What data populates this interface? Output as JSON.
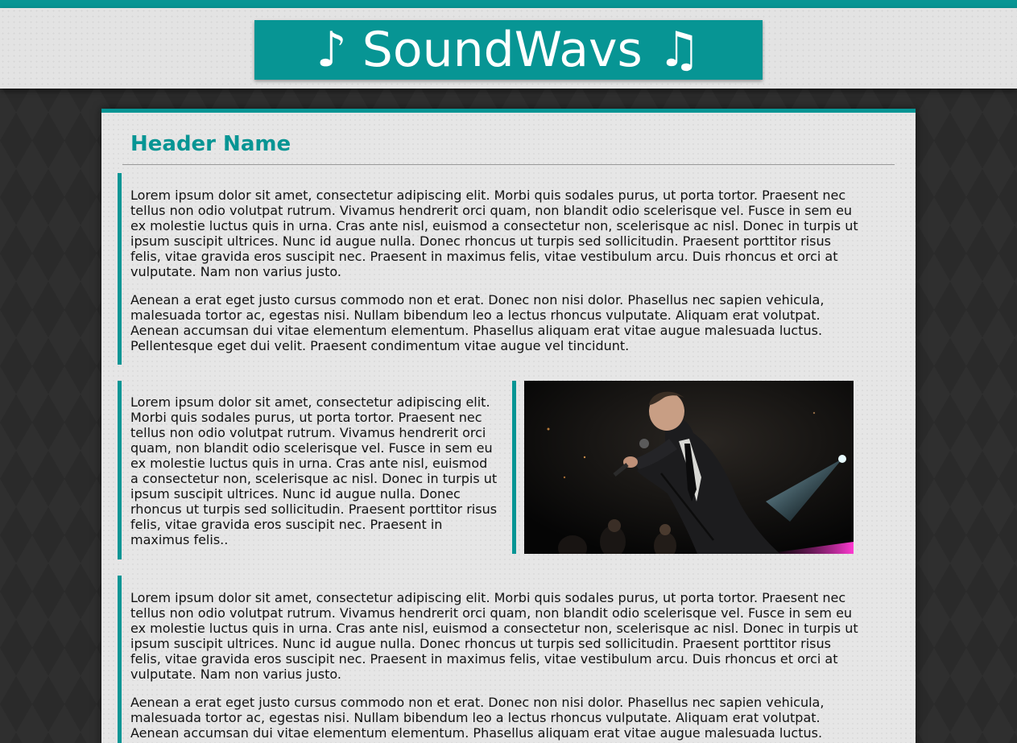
{
  "site": {
    "logo_text": "♪ SoundWavs ♫",
    "accent_color": "#079594"
  },
  "main": {
    "title": "Header Name",
    "block1": {
      "p1": "Lorem ipsum dolor sit amet, consectetur adipiscing elit. Morbi quis sodales purus, ut porta tortor. Praesent nec tellus non odio volutpat rutrum. Vivamus hendrerit orci quam, non blandit odio scelerisque vel. Fusce in sem eu ex molestie luctus quis in urna. Cras ante nisl, euismod a consectetur non, scelerisque ac nisl. Donec in turpis ut ipsum suscipit ultrices. Nunc id augue nulla. Donec rhoncus ut turpis sed sollicitudin. Praesent porttitor risus felis, vitae gravida eros suscipit nec. Praesent in maximus felis, vitae vestibulum arcu. Duis rhoncus et orci at vulputate. Nam non varius justo.",
      "p2": "Aenean a erat eget justo cursus commodo non et erat. Donec non nisi dolor. Phasellus nec sapien vehicula, malesuada tortor ac, egestas nisi. Nullam bibendum leo a lectus rhoncus vulputate. Aliquam erat volutpat. Aenean accumsan dui vitae elementum elementum. Phasellus aliquam erat vitae augue malesuada luctus. Pellentesque eget dui velit. Praesent condimentum vitae augue vel tincidunt."
    },
    "block2": {
      "p1": "Lorem ipsum dolor sit amet, consectetur adipiscing elit. Morbi quis sodales purus, ut porta tortor. Praesent nec tellus non odio volutpat rutrum. Vivamus hendrerit orci quam, non blandit odio scelerisque vel. Fusce in sem eu ex molestie luctus quis in urna. Cras ante nisl, euismod a consectetur non, scelerisque ac nisl. Donec in turpis ut ipsum suscipit ultrices. Nunc id augue nulla. Donec rhoncus ut turpis sed sollicitudin. Praesent porttitor risus felis, vitae gravida eros suscipit nec. Praesent in maximus felis.."
    },
    "block3": {
      "p1": "Lorem ipsum dolor sit amet, consectetur adipiscing elit. Morbi quis sodales purus, ut porta tortor. Praesent nec tellus non odio volutpat rutrum. Vivamus hendrerit orci quam, non blandit odio scelerisque vel. Fusce in sem eu ex molestie luctus quis in urna. Cras ante nisl, euismod a consectetur non, scelerisque ac nisl. Donec in turpis ut ipsum suscipit ultrices. Nunc id augue nulla. Donec rhoncus ut turpis sed sollicitudin. Praesent porttitor risus felis, vitae gravida eros suscipit nec. Praesent in maximus felis, vitae vestibulum arcu. Duis rhoncus et orci at vulputate. Nam non varius justo.",
      "p2": "Aenean a erat eget justo cursus commodo non et erat. Donec non nisi dolor. Phasellus nec sapien vehicula, malesuada tortor ac, egestas nisi. Nullam bibendum leo a lectus rhoncus vulputate. Aliquam erat volutpat. Aenean accumsan dui vitae elementum elementum. Phasellus aliquam erat vitae augue malesuada luctus. Pellentesque eget dui velit. Praesent condimentum vitae augue vel tincidunt."
    },
    "photo_icon": "concert-singer-photo"
  }
}
